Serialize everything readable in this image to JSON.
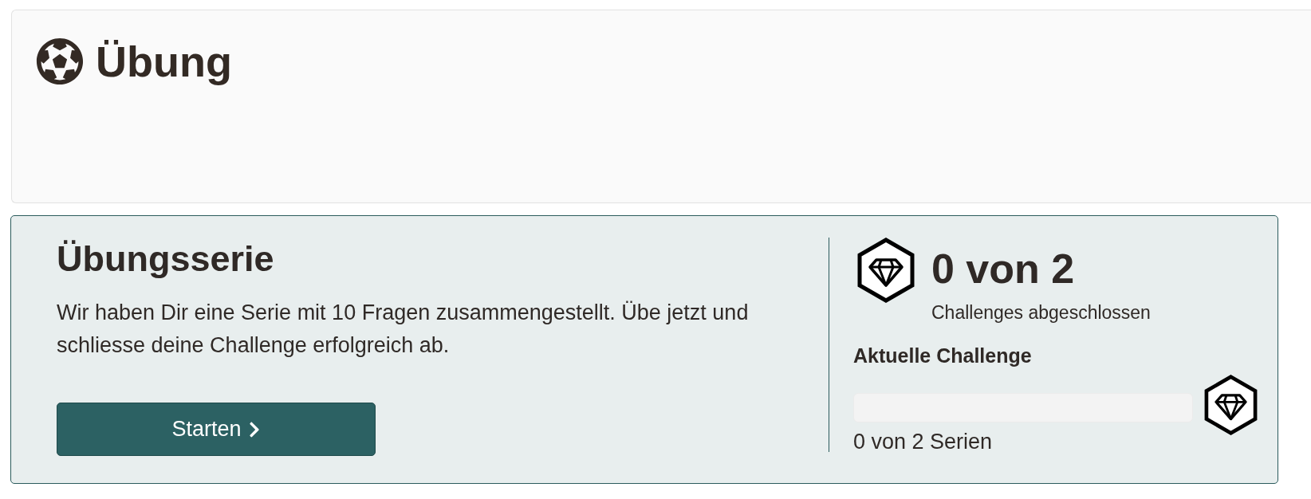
{
  "header": {
    "title": "Übung"
  },
  "practice": {
    "title": "Übungsserie",
    "description": "Wir haben Dir eine Serie mit 10 Fragen zusammengestellt. Übe jetzt und schliesse deine Challenge erfolgreich ab.",
    "button": "Starten"
  },
  "stats": {
    "completed": "0 von 2",
    "completed_label": "Challenges abgeschlossen",
    "current_title": "Aktuelle Challenge",
    "progress": {
      "level": 0,
      "reading": "0 von 2 Serien"
    }
  }
}
